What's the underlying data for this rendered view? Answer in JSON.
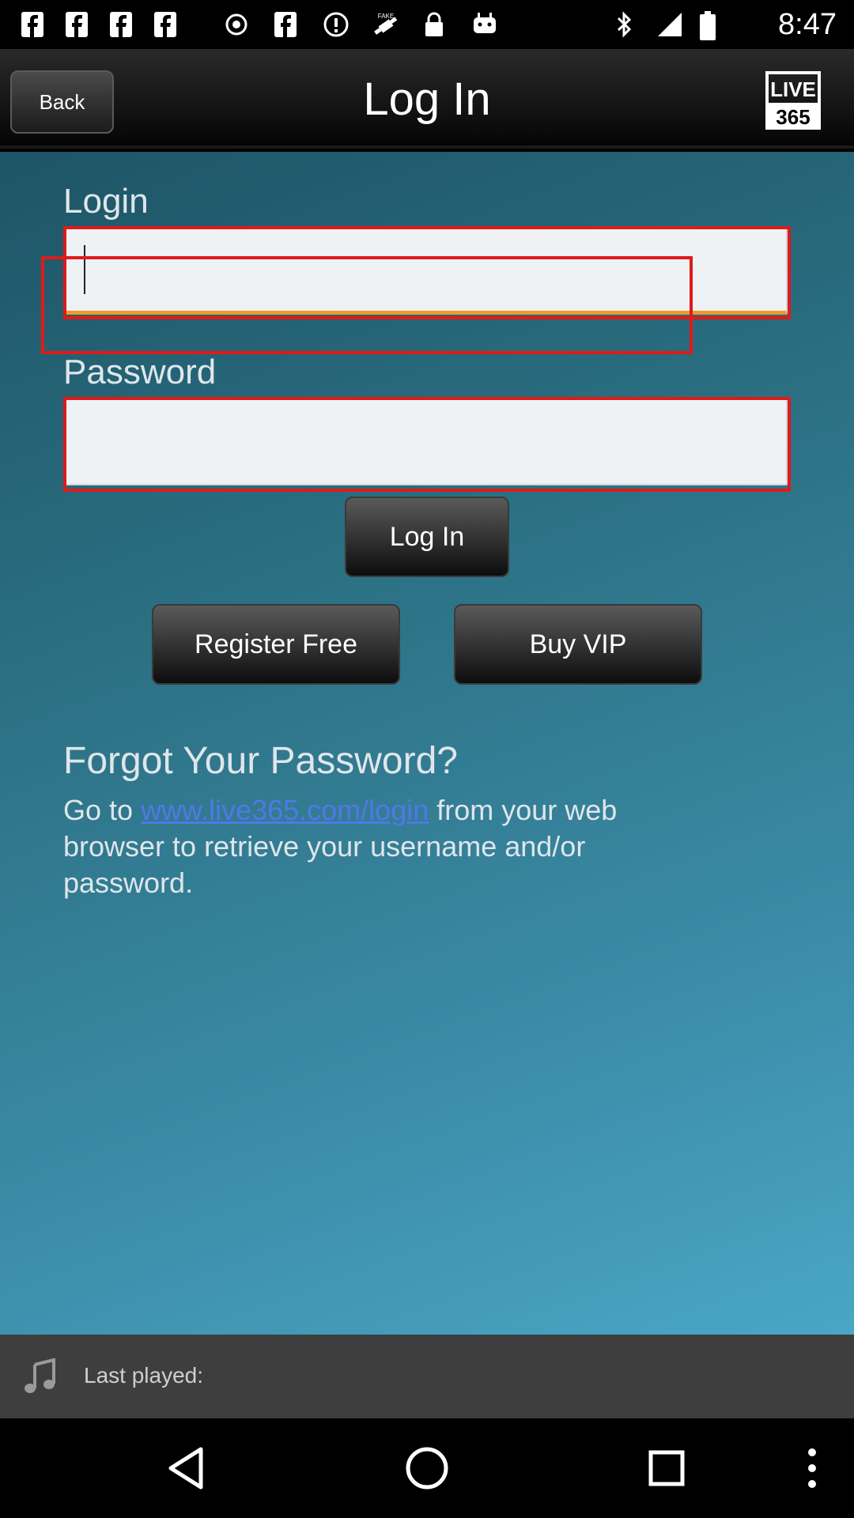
{
  "status_bar": {
    "time": "8:47",
    "icons": [
      "facebook-icon",
      "facebook-icon",
      "facebook-icon",
      "facebook-icon",
      "record-icon",
      "facebook-icon",
      "info-icon",
      "fake-gps-icon",
      "lock-icon",
      "android-icon",
      "bluetooth-icon",
      "signal-icon",
      "battery-icon"
    ]
  },
  "header": {
    "back_label": "Back",
    "title": "Log In",
    "logo_top": "LIVE",
    "logo_bottom": "365"
  },
  "form": {
    "login_label": "Login",
    "login_value": "",
    "password_label": "Password",
    "password_value": "",
    "login_button": "Log In",
    "register_button": "Register Free",
    "vip_button": "Buy VIP"
  },
  "forgot": {
    "title": "Forgot Your Password?",
    "text_prefix": "Go to ",
    "link_text": "www.live365.com/login",
    "text_suffix": " from your web browser to retrieve your username and/or password."
  },
  "last_played": {
    "label": "Last played:"
  },
  "nav": {
    "icons": [
      "back-icon",
      "home-icon",
      "recents-icon",
      "more-icon"
    ]
  },
  "colors": {
    "highlight_box": "#e01a1a",
    "input_focus_underline": "#f09a2c",
    "link": "#5078e6"
  }
}
